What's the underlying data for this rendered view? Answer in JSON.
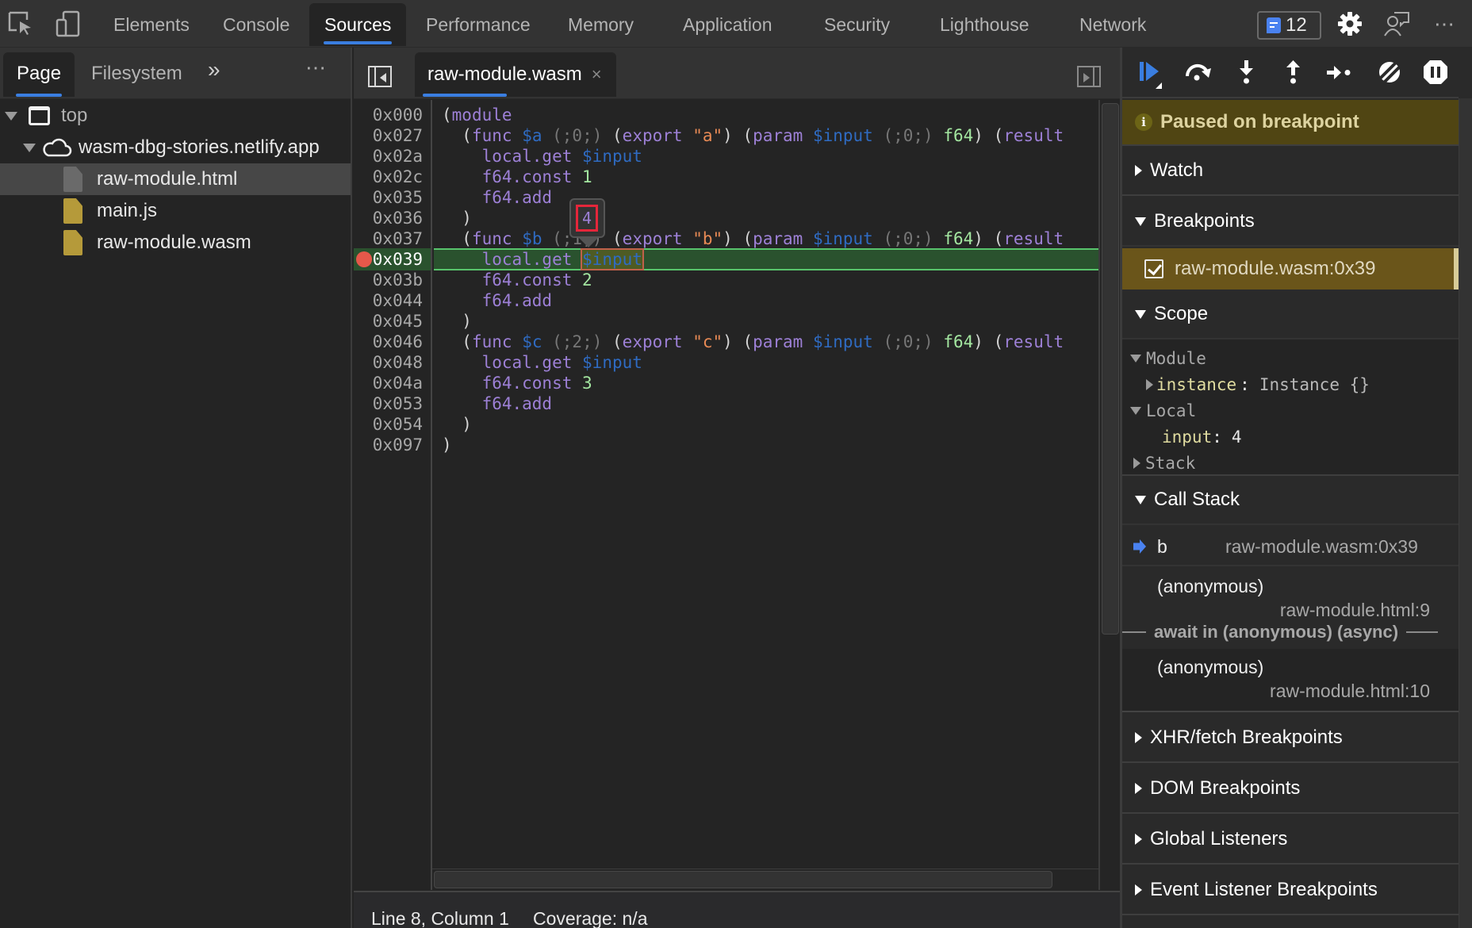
{
  "main_tabs": [
    {
      "label": "Elements",
      "active": false
    },
    {
      "label": "Console",
      "active": false
    },
    {
      "label": "Sources",
      "active": true
    },
    {
      "label": "Performance",
      "active": false
    },
    {
      "label": "Memory",
      "active": false
    },
    {
      "label": "Application",
      "active": false
    },
    {
      "label": "Security",
      "active": false
    },
    {
      "label": "Lighthouse",
      "active": false
    },
    {
      "label": "Network",
      "active": false
    }
  ],
  "toolbar_icons": {
    "inspect": "inspect-element-icon",
    "device": "device-toolbar-icon",
    "settings": "gear-icon",
    "feedback": "feedback-icon",
    "more": "more-options-icon"
  },
  "issues_badge": {
    "count": "12",
    "color": "#4a82f0"
  },
  "navigator": {
    "tabs": [
      {
        "label": "Page",
        "active": true
      },
      {
        "label": "Filesystem",
        "active": false
      }
    ],
    "more_tabs": "»",
    "menu": "⋯",
    "tree": [
      {
        "label": "top",
        "type": "frame",
        "expanded": true
      },
      {
        "label": "wasm-dbg-stories.netlify.app",
        "type": "domain",
        "expanded": true
      },
      {
        "label": "raw-module.html",
        "type": "file-html",
        "selected": true
      },
      {
        "label": "main.js",
        "type": "file-script",
        "selected": false
      },
      {
        "label": "raw-module.wasm",
        "type": "file-script",
        "selected": false
      }
    ]
  },
  "editor": {
    "tab_label": "raw-module.wasm",
    "tab_close": "×",
    "lines": [
      {
        "addr": "0x000",
        "text": "(module"
      },
      {
        "addr": "0x027",
        "text": "  (func $a (;0;) (export \"a\") (param $input (;0;) f64) (result"
      },
      {
        "addr": "0x02a",
        "text": "    local.get $input"
      },
      {
        "addr": "0x02c",
        "text": "    f64.const 1"
      },
      {
        "addr": "0x035",
        "text": "    f64.add"
      },
      {
        "addr": "0x036",
        "text": "  )"
      },
      {
        "addr": "0x037",
        "text": "  (func $b (;1;) (export \"b\") (param $input (;0;) f64) (result"
      },
      {
        "addr": "0x039",
        "text": "    local.get $input",
        "breakpoint": true,
        "current": true
      },
      {
        "addr": "0x03b",
        "text": "    f64.const 2"
      },
      {
        "addr": "0x044",
        "text": "    f64.add"
      },
      {
        "addr": "0x045",
        "text": "  )"
      },
      {
        "addr": "0x046",
        "text": "  (func $c (;2;) (export \"c\") (param $input (;0;) f64) (result"
      },
      {
        "addr": "0x048",
        "text": "    local.get $input"
      },
      {
        "addr": "0x04a",
        "text": "    f64.const 3"
      },
      {
        "addr": "0x053",
        "text": "    f64.add"
      },
      {
        "addr": "0x054",
        "text": "  )"
      },
      {
        "addr": "0x097",
        "text": ")"
      }
    ],
    "hover_tooltip_value": "4",
    "status": {
      "position": "Line 8, Column 1",
      "coverage": "Coverage: n/a"
    }
  },
  "debugger": {
    "controls": [
      {
        "name": "resume",
        "icon": "resume-icon",
        "color": "#3a7ee0"
      },
      {
        "name": "step-over",
        "icon": "step-over-icon"
      },
      {
        "name": "step-into",
        "icon": "step-into-icon"
      },
      {
        "name": "step-out",
        "icon": "step-out-icon"
      },
      {
        "name": "step",
        "icon": "step-icon"
      },
      {
        "name": "deactivate-breakpoints",
        "icon": "deactivate-breakpoints-icon"
      },
      {
        "name": "pause-on-exceptions",
        "icon": "pause-on-exceptions-icon"
      }
    ],
    "paused_message": "Paused on breakpoint",
    "watch": {
      "label": "Watch",
      "expanded": false
    },
    "breakpoints": {
      "label": "Breakpoints",
      "expanded": true,
      "items": [
        {
          "label": "raw-module.wasm:0x39",
          "checked": true
        }
      ]
    },
    "scope": {
      "label": "Scope",
      "expanded": true,
      "module": {
        "label": "Module",
        "instance_name": "instance",
        "instance_value": "Instance {}"
      },
      "local": {
        "label": "Local",
        "var_name": "input",
        "var_value": "4"
      },
      "stack": {
        "label": "Stack"
      }
    },
    "call_stack": {
      "label": "Call Stack",
      "frames": [
        {
          "name": "b",
          "location": "raw-module.wasm:0x39",
          "current": true
        },
        {
          "name": "(anonymous)",
          "location": "raw-module.html:9"
        }
      ],
      "async_label": "await in (anonymous) (async)",
      "async_frames": [
        {
          "name": "(anonymous)",
          "location": "raw-module.html:10"
        }
      ]
    },
    "collapsed_sections": [
      "XHR/fetch Breakpoints",
      "DOM Breakpoints",
      "Global Listeners",
      "Event Listener Breakpoints"
    ]
  }
}
